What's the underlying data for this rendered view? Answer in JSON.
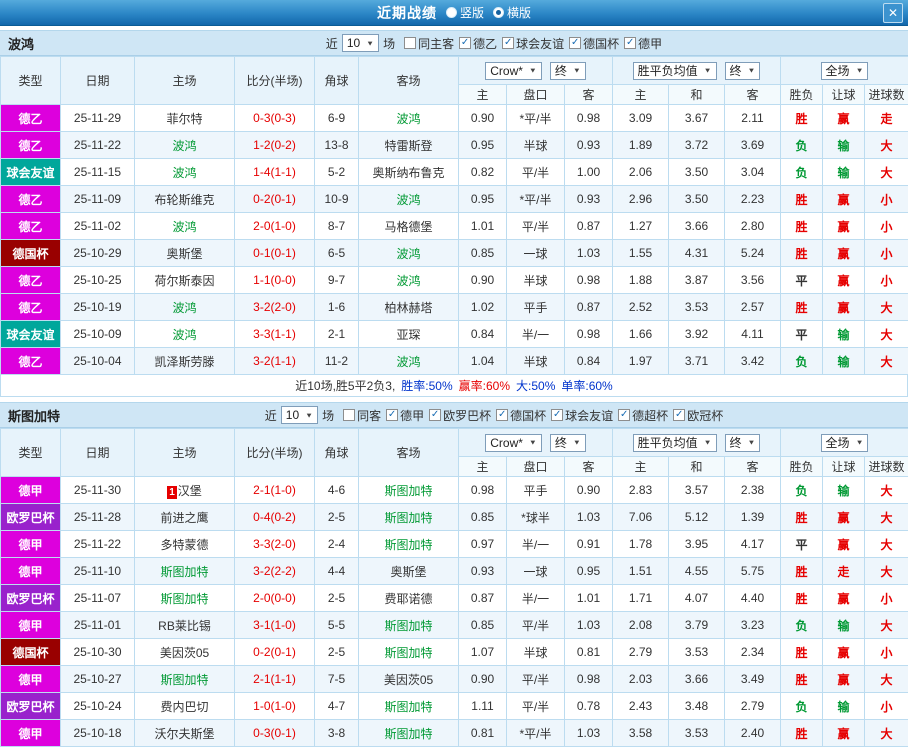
{
  "titlebar": {
    "title": "近期战绩",
    "radios": [
      {
        "label": "竖版",
        "selected": false
      },
      {
        "label": "横版",
        "selected": true
      }
    ],
    "close_glyph": "✕"
  },
  "labels": {
    "near": "近",
    "count": "10",
    "games": "场",
    "bookmaker": "Crow*",
    "final": "终",
    "avg": "胜平负均值",
    "scope": "全场"
  },
  "columns": {
    "type": "类型",
    "date": "日期",
    "home": "主场",
    "score": "比分(半场)",
    "corner": "角球",
    "away": "客场",
    "odds_home": "主",
    "handicap": "盘口",
    "odds_away": "客",
    "avg_home": "主",
    "avg_draw": "和",
    "avg_away": "客",
    "result": "胜负",
    "let_ball": "让球",
    "goals": "进球数"
  },
  "type_colors": {
    "德乙": "#dd00dd",
    "德甲": "#dd00dd",
    "球会友谊": "#00a79b",
    "德国杯": "#990000",
    "欧罗巴杯": "#9922cc"
  },
  "result_colors": {
    "胜": "#e60000",
    "负": "#009933",
    "平": "#333333",
    "赢": "#e60000",
    "输": "#009933",
    "走": "#e60000",
    "大": "#e60000",
    "小": "#e60000"
  },
  "sections": [
    {
      "team": "波鸿",
      "filters": [
        {
          "label": "同主客",
          "checked": false
        },
        {
          "label": "德乙",
          "checked": true
        },
        {
          "label": "球会友谊",
          "checked": true
        },
        {
          "label": "德国杯",
          "checked": true
        },
        {
          "label": "德甲",
          "checked": true
        }
      ],
      "rows": [
        {
          "type": "德乙",
          "date": "25-11-29",
          "home": "菲尔特",
          "home_focus": false,
          "score": "0-3(0-3)",
          "corner": "6-9",
          "away": "波鸿",
          "away_focus": true,
          "odds": [
            "0.90",
            "*平/半",
            "0.98"
          ],
          "avg": [
            "3.09",
            "3.67",
            "2.11"
          ],
          "results": [
            "胜",
            "赢",
            "走"
          ]
        },
        {
          "type": "德乙",
          "date": "25-11-22",
          "home": "波鸿",
          "home_focus": true,
          "score": "1-2(0-2)",
          "corner": "13-8",
          "away": "特雷斯登",
          "away_focus": false,
          "odds": [
            "0.95",
            "半球",
            "0.93"
          ],
          "avg": [
            "1.89",
            "3.72",
            "3.69"
          ],
          "results": [
            "负",
            "输",
            "大"
          ]
        },
        {
          "type": "球会友谊",
          "date": "25-11-15",
          "home": "波鸿",
          "home_focus": true,
          "score": "1-4(1-1)",
          "corner": "5-2",
          "away": "奥斯纳布鲁克",
          "away_focus": false,
          "odds": [
            "0.82",
            "平/半",
            "1.00"
          ],
          "avg": [
            "2.06",
            "3.50",
            "3.04"
          ],
          "results": [
            "负",
            "输",
            "大"
          ]
        },
        {
          "type": "德乙",
          "date": "25-11-09",
          "home": "布轮斯维克",
          "home_focus": false,
          "score": "0-2(0-1)",
          "corner": "10-9",
          "away": "波鸿",
          "away_focus": true,
          "odds": [
            "0.95",
            "*平/半",
            "0.93"
          ],
          "avg": [
            "2.96",
            "3.50",
            "2.23"
          ],
          "results": [
            "胜",
            "赢",
            "小"
          ]
        },
        {
          "type": "德乙",
          "date": "25-11-02",
          "home": "波鸿",
          "home_focus": true,
          "score": "2-0(1-0)",
          "corner": "8-7",
          "away": "马格德堡",
          "away_focus": false,
          "odds": [
            "1.01",
            "平/半",
            "0.87"
          ],
          "avg": [
            "1.27",
            "3.66",
            "2.80"
          ],
          "results": [
            "胜",
            "赢",
            "小"
          ]
        },
        {
          "type": "德国杯",
          "date": "25-10-29",
          "home": "奥斯堡",
          "home_focus": false,
          "score": "0-1(0-1)",
          "corner": "6-5",
          "away": "波鸿",
          "away_focus": true,
          "odds": [
            "0.85",
            "一球",
            "1.03"
          ],
          "avg": [
            "1.55",
            "4.31",
            "5.24"
          ],
          "results": [
            "胜",
            "赢",
            "小"
          ]
        },
        {
          "type": "德乙",
          "date": "25-10-25",
          "home": "荷尔斯泰因",
          "home_focus": false,
          "score": "1-1(0-0)",
          "corner": "9-7",
          "away": "波鸿",
          "away_focus": true,
          "odds": [
            "0.90",
            "半球",
            "0.98"
          ],
          "avg": [
            "1.88",
            "3.87",
            "3.56"
          ],
          "results": [
            "平",
            "赢",
            "小"
          ]
        },
        {
          "type": "德乙",
          "date": "25-10-19",
          "home": "波鸿",
          "home_focus": true,
          "score": "3-2(2-0)",
          "corner": "1-6",
          "away": "柏林赫塔",
          "away_focus": false,
          "odds": [
            "1.02",
            "平手",
            "0.87"
          ],
          "avg": [
            "2.52",
            "3.53",
            "2.57"
          ],
          "results": [
            "胜",
            "赢",
            "大"
          ]
        },
        {
          "type": "球会友谊",
          "date": "25-10-09",
          "home": "波鸿",
          "home_focus": true,
          "score": "3-3(1-1)",
          "corner": "2-1",
          "away": "亚琛",
          "away_focus": false,
          "odds": [
            "0.84",
            "半/一",
            "0.98"
          ],
          "avg": [
            "1.66",
            "3.92",
            "4.11"
          ],
          "results": [
            "平",
            "输",
            "大"
          ]
        },
        {
          "type": "德乙",
          "date": "25-10-04",
          "home": "凯泽斯劳滕",
          "home_focus": false,
          "score": "3-2(1-1)",
          "corner": "11-2",
          "away": "波鸿",
          "away_focus": true,
          "odds": [
            "1.04",
            "半球",
            "0.84"
          ],
          "avg": [
            "1.97",
            "3.71",
            "3.42"
          ],
          "results": [
            "负",
            "输",
            "大"
          ]
        }
      ],
      "summary": [
        {
          "text": "近10场,胜5平2负3,",
          "color": "#333333"
        },
        {
          "text": "胜率:50%",
          "color": "#0033cc"
        },
        {
          "text": "赢率:60%",
          "color": "#e60000"
        },
        {
          "text": "大:50%",
          "color": "#0033cc"
        },
        {
          "text": "单率:60%",
          "color": "#0033cc"
        }
      ]
    },
    {
      "team": "斯图加特",
      "filters": [
        {
          "label": "同客",
          "checked": false
        },
        {
          "label": "德甲",
          "checked": true
        },
        {
          "label": "欧罗巴杯",
          "checked": true
        },
        {
          "label": "德国杯",
          "checked": true
        },
        {
          "label": "球会友谊",
          "checked": true
        },
        {
          "label": "德超杯",
          "checked": true
        },
        {
          "label": "欧冠杯",
          "checked": true
        }
      ],
      "rows": [
        {
          "type": "德甲",
          "date": "25-11-30",
          "home": "汉堡",
          "home_badge": "1",
          "home_focus": false,
          "score": "2-1(1-0)",
          "corner": "4-6",
          "away": "斯图加特",
          "away_focus": true,
          "odds": [
            "0.98",
            "平手",
            "0.90"
          ],
          "avg": [
            "2.83",
            "3.57",
            "2.38"
          ],
          "results": [
            "负",
            "输",
            "大"
          ]
        },
        {
          "type": "欧罗巴杯",
          "date": "25-11-28",
          "home": "前进之鹰",
          "home_focus": false,
          "score": "0-4(0-2)",
          "corner": "2-5",
          "away": "斯图加特",
          "away_focus": true,
          "odds": [
            "0.85",
            "*球半",
            "1.03"
          ],
          "avg": [
            "7.06",
            "5.12",
            "1.39"
          ],
          "results": [
            "胜",
            "赢",
            "大"
          ]
        },
        {
          "type": "德甲",
          "date": "25-11-22",
          "home": "多特蒙德",
          "home_focus": false,
          "score": "3-3(2-0)",
          "corner": "2-4",
          "away": "斯图加特",
          "away_focus": true,
          "odds": [
            "0.97",
            "半/一",
            "0.91"
          ],
          "avg": [
            "1.78",
            "3.95",
            "4.17"
          ],
          "results": [
            "平",
            "赢",
            "大"
          ]
        },
        {
          "type": "德甲",
          "date": "25-11-10",
          "home": "斯图加特",
          "home_focus": true,
          "score": "3-2(2-2)",
          "corner": "4-4",
          "away": "奥斯堡",
          "away_focus": false,
          "odds": [
            "0.93",
            "一球",
            "0.95"
          ],
          "avg": [
            "1.51",
            "4.55",
            "5.75"
          ],
          "results": [
            "胜",
            "走",
            "大"
          ]
        },
        {
          "type": "欧罗巴杯",
          "date": "25-11-07",
          "home": "斯图加特",
          "home_focus": true,
          "score": "2-0(0-0)",
          "corner": "2-5",
          "away": "费耶诺德",
          "away_focus": false,
          "odds": [
            "0.87",
            "半/一",
            "1.01"
          ],
          "avg": [
            "1.71",
            "4.07",
            "4.40"
          ],
          "results": [
            "胜",
            "赢",
            "小"
          ]
        },
        {
          "type": "德甲",
          "date": "25-11-01",
          "home": "RB莱比锡",
          "home_focus": false,
          "score": "3-1(1-0)",
          "corner": "5-5",
          "away": "斯图加特",
          "away_focus": true,
          "odds": [
            "0.85",
            "平/半",
            "1.03"
          ],
          "avg": [
            "2.08",
            "3.79",
            "3.23"
          ],
          "results": [
            "负",
            "输",
            "大"
          ]
        },
        {
          "type": "德国杯",
          "date": "25-10-30",
          "home": "美因茨05",
          "home_focus": false,
          "score": "0-2(0-1)",
          "corner": "2-5",
          "away": "斯图加特",
          "away_focus": true,
          "odds": [
            "1.07",
            "半球",
            "0.81"
          ],
          "avg": [
            "2.79",
            "3.53",
            "2.34"
          ],
          "results": [
            "胜",
            "赢",
            "小"
          ]
        },
        {
          "type": "德甲",
          "date": "25-10-27",
          "home": "斯图加特",
          "home_focus": true,
          "score": "2-1(1-1)",
          "corner": "7-5",
          "away": "美因茨05",
          "away_focus": false,
          "odds": [
            "0.90",
            "平/半",
            "0.98"
          ],
          "avg": [
            "2.03",
            "3.66",
            "3.49"
          ],
          "results": [
            "胜",
            "赢",
            "大"
          ]
        },
        {
          "type": "欧罗巴杯",
          "date": "25-10-24",
          "home": "费内巴切",
          "home_focus": false,
          "score": "1-0(1-0)",
          "corner": "4-7",
          "away": "斯图加特",
          "away_focus": true,
          "odds": [
            "1.11",
            "平/半",
            "0.78"
          ],
          "avg": [
            "2.43",
            "3.48",
            "2.79"
          ],
          "results": [
            "负",
            "输",
            "小"
          ]
        },
        {
          "type": "德甲",
          "date": "25-10-18",
          "home": "沃尔夫斯堡",
          "home_focus": false,
          "score": "0-3(0-1)",
          "corner": "3-8",
          "away": "斯图加特",
          "away_focus": true,
          "odds": [
            "0.81",
            "*平/半",
            "1.03"
          ],
          "avg": [
            "3.58",
            "3.53",
            "2.40"
          ],
          "results": [
            "胜",
            "赢",
            "大"
          ]
        }
      ]
    }
  ]
}
